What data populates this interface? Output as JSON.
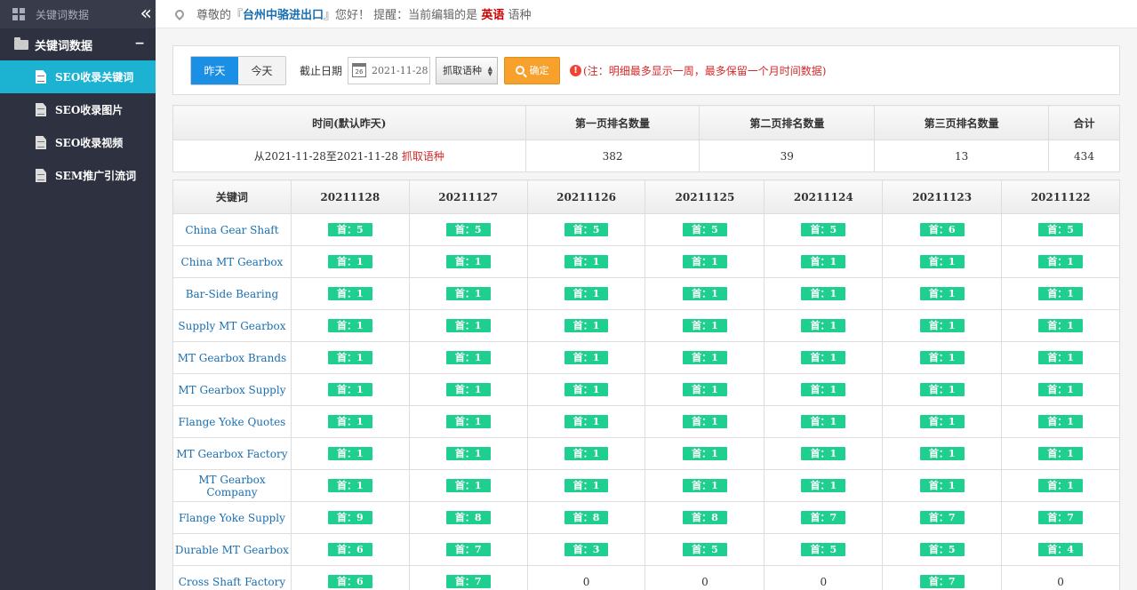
{
  "sidebar": {
    "top_label": "关键词数据",
    "collapse_glyph": "«",
    "group_label": "关键词数据",
    "group_toggle": "−",
    "items": [
      {
        "label": "SEO收录关键词",
        "active": true
      },
      {
        "label": "SEO收录图片",
        "active": false
      },
      {
        "label": "SEO收录视频",
        "active": false
      },
      {
        "label": "SEM推广引流词",
        "active": false
      }
    ]
  },
  "header": {
    "greeting_prefix": "尊敬的『",
    "company": "台州中骆进出口",
    "greeting_mid": "』您好！ 提醒：当前编辑的是",
    "language": "英语",
    "greeting_suffix": "语种"
  },
  "filter": {
    "yesterday": "昨天",
    "today": "今天",
    "date_label": "截止日期",
    "calendar_day": "26",
    "date_value": "2021-11-28",
    "select_value": "抓取语种",
    "confirm": "确定",
    "note": "(注：明细最多显示一周，最多保留一个月时间数据)"
  },
  "summary": {
    "headers": [
      "时间(默认昨天)",
      "第一页排名数量",
      "第二页排名数量",
      "第三页排名数量",
      "合计"
    ],
    "range_text": "从2021-11-28至2021-11-28",
    "range_lang": "抓取语种",
    "values": [
      "382",
      "39",
      "13",
      "434"
    ]
  },
  "detail": {
    "headers": [
      "关键词",
      "20211128",
      "20211127",
      "20211126",
      "20211125",
      "20211124",
      "20211123",
      "20211122"
    ],
    "rows": [
      {
        "keyword": "China Gear Shaft",
        "cells": [
          "首：5",
          "首：5",
          "首：5",
          "首：5",
          "首：5",
          "首：6",
          "首：5"
        ]
      },
      {
        "keyword": "China MT Gearbox",
        "cells": [
          "首：1",
          "首：1",
          "首：1",
          "首：1",
          "首：1",
          "首：1",
          "首：1"
        ]
      },
      {
        "keyword": "Bar-Side Bearing",
        "cells": [
          "首：1",
          "首：1",
          "首：1",
          "首：1",
          "首：1",
          "首：1",
          "首：1"
        ]
      },
      {
        "keyword": "Supply MT Gearbox",
        "cells": [
          "首：1",
          "首：1",
          "首：1",
          "首：1",
          "首：1",
          "首：1",
          "首：1"
        ]
      },
      {
        "keyword": "MT Gearbox Brands",
        "cells": [
          "首：1",
          "首：1",
          "首：1",
          "首：1",
          "首：1",
          "首：1",
          "首：1"
        ]
      },
      {
        "keyword": "MT Gearbox Supply",
        "cells": [
          "首：1",
          "首：1",
          "首：1",
          "首：1",
          "首：1",
          "首：1",
          "首：1"
        ]
      },
      {
        "keyword": "Flange Yoke Quotes",
        "cells": [
          "首：1",
          "首：1",
          "首：1",
          "首：1",
          "首：1",
          "首：1",
          "首：1"
        ]
      },
      {
        "keyword": "MT Gearbox Factory",
        "cells": [
          "首：1",
          "首：1",
          "首：1",
          "首：1",
          "首：1",
          "首：1",
          "首：1"
        ]
      },
      {
        "keyword": "MT Gearbox Company",
        "cells": [
          "首：1",
          "首：1",
          "首：1",
          "首：1",
          "首：1",
          "首：1",
          "首：1"
        ]
      },
      {
        "keyword": "Flange Yoke Supply",
        "cells": [
          "首：9",
          "首：8",
          "首：8",
          "首：8",
          "首：7",
          "首：7",
          "首：7"
        ]
      },
      {
        "keyword": "Durable MT Gearbox",
        "cells": [
          "首：6",
          "首：7",
          "首：3",
          "首：5",
          "首：5",
          "首：5",
          "首：4"
        ]
      },
      {
        "keyword": "Cross Shaft Factory",
        "cells": [
          "首：6",
          "首：7",
          "0",
          "0",
          "0",
          "首：7",
          "0"
        ]
      }
    ]
  },
  "colors": {
    "sidebar_bg": "#2e3240",
    "active_item": "#1cb2d1",
    "badge": "#1fcf8f",
    "primary_button": "#1a8fe3",
    "confirm_button": "#f7a02c",
    "link": "#1a6fb0",
    "warning": "#d42a2a"
  },
  "icons": [
    "grid-icon",
    "collapse-icon",
    "folder-icon",
    "document-icon",
    "location-pin-icon",
    "calendar-icon",
    "search-icon",
    "warning-icon"
  ]
}
